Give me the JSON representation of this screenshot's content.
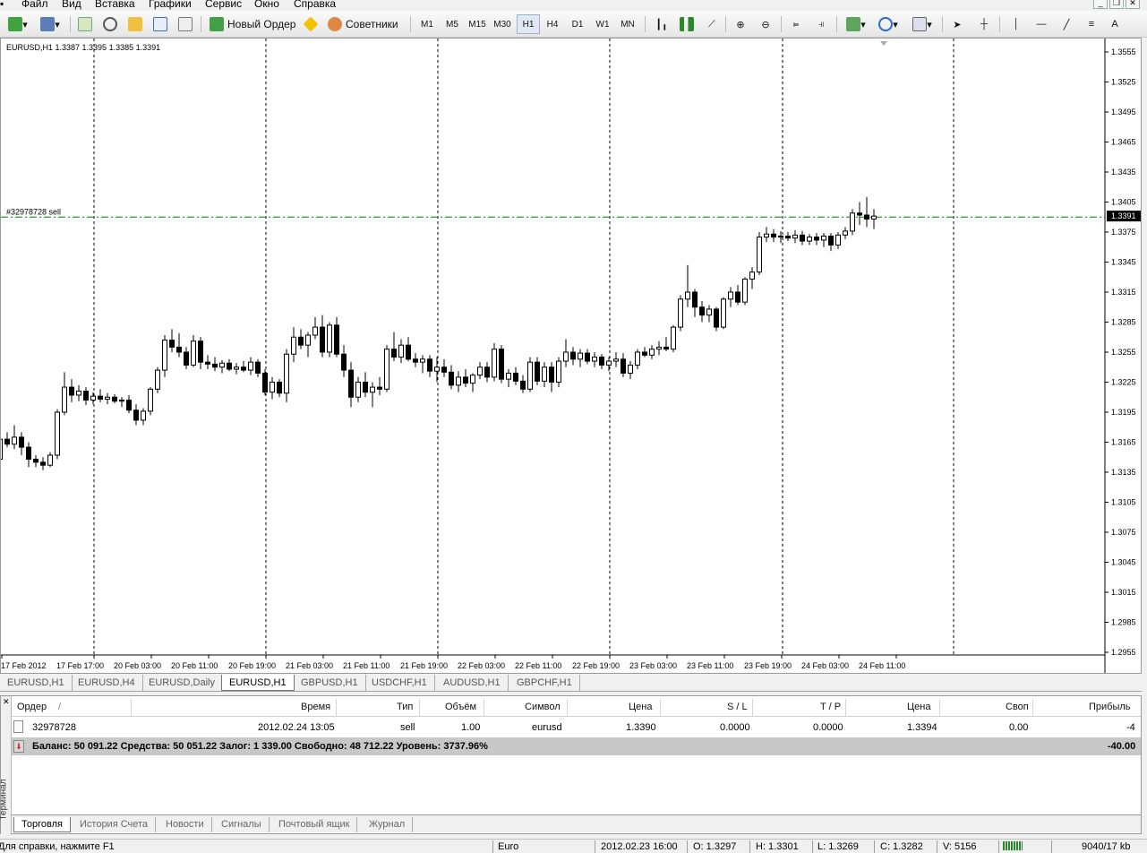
{
  "menu": [
    "Файл",
    "Вид",
    "Вставка",
    "Графики",
    "Сервис",
    "Окно",
    "Справка"
  ],
  "toolbar": {
    "new_order": "Новый Ордер",
    "experts": "Советники",
    "timeframes": [
      "M1",
      "M5",
      "M15",
      "M30",
      "H1",
      "H4",
      "D1",
      "W1",
      "MN"
    ],
    "active_timeframe": "H1"
  },
  "chart": {
    "header": "EURUSD,H1  1.3387 1.3395 1.3385 1.3391",
    "order_label": "#32978728 sell",
    "current_price": "1.3391",
    "order_line_color": "#008000",
    "price_ticks": [
      "1.3555",
      "1.3525",
      "1.3495",
      "1.3465",
      "1.3435",
      "1.3405",
      "1.3375",
      "1.3345",
      "1.3315",
      "1.3285",
      "1.3255",
      "1.3225",
      "1.3195",
      "1.3165",
      "1.3135",
      "1.3105",
      "1.3075",
      "1.3045",
      "1.3015",
      "1.2985",
      "1.2955"
    ],
    "time_ticks": [
      "17 Feb 2012",
      "17 Feb 17:00",
      "20 Feb 03:00",
      "20 Feb 11:00",
      "20 Feb 19:00",
      "21 Feb 03:00",
      "21 Feb 11:00",
      "21 Feb 19:00",
      "22 Feb 03:00",
      "22 Feb 11:00",
      "22 Feb 19:00",
      "23 Feb 03:00",
      "23 Feb 11:00",
      "23 Feb 19:00",
      "24 Feb 03:00",
      "24 Feb 11:00"
    ]
  },
  "chart_data": {
    "type": "candlestick",
    "symbol": "EURUSD",
    "timeframe": "H1",
    "ylim": [
      1.294,
      1.357
    ],
    "candles": [
      [
        1.312,
        1.314,
        1.3115,
        1.3132
      ],
      [
        1.3132,
        1.3138,
        1.3114,
        1.3118
      ],
      [
        1.3118,
        1.3148,
        1.3116,
        1.3145
      ],
      [
        1.3145,
        1.3162,
        1.314,
        1.3155
      ],
      [
        1.3155,
        1.3172,
        1.314,
        1.3142
      ],
      [
        1.3142,
        1.315,
        1.3128,
        1.3135
      ],
      [
        1.3135,
        1.3152,
        1.313,
        1.3148
      ],
      [
        1.3148,
        1.317,
        1.3145,
        1.3168
      ],
      [
        1.3168,
        1.3175,
        1.316,
        1.3163
      ],
      [
        1.3163,
        1.3182,
        1.3158,
        1.317
      ],
      [
        1.317,
        1.3175,
        1.3152,
        1.316
      ],
      [
        1.316,
        1.3165,
        1.314,
        1.3148
      ],
      [
        1.3148,
        1.3152,
        1.314,
        1.3145
      ],
      [
        1.3145,
        1.315,
        1.3137,
        1.3142
      ],
      [
        1.3142,
        1.3155,
        1.314,
        1.3152
      ],
      [
        1.3152,
        1.3198,
        1.3148,
        1.3195
      ],
      [
        1.3195,
        1.3235,
        1.3192,
        1.322
      ],
      [
        1.322,
        1.3228,
        1.3205,
        1.3212
      ],
      [
        1.3212,
        1.3222,
        1.3206,
        1.3216
      ],
      [
        1.3216,
        1.322,
        1.3202,
        1.3207
      ],
      [
        1.3207,
        1.3215,
        1.3203,
        1.3211
      ],
      [
        1.3211,
        1.3218,
        1.3205,
        1.3208
      ],
      [
        1.3208,
        1.3214,
        1.3203,
        1.321
      ],
      [
        1.321,
        1.3213,
        1.3204,
        1.3206
      ],
      [
        1.3206,
        1.321,
        1.32,
        1.3207
      ],
      [
        1.3207,
        1.3212,
        1.3194,
        1.3197
      ],
      [
        1.3197,
        1.3203,
        1.3182,
        1.3187
      ],
      [
        1.3187,
        1.3199,
        1.3182,
        1.3196
      ],
      [
        1.3196,
        1.322,
        1.3192,
        1.3218
      ],
      [
        1.3218,
        1.324,
        1.3214,
        1.3237
      ],
      [
        1.3237,
        1.3272,
        1.323,
        1.3267
      ],
      [
        1.3267,
        1.3278,
        1.3255,
        1.326
      ],
      [
        1.326,
        1.3274,
        1.325,
        1.3255
      ],
      [
        1.3255,
        1.326,
        1.3238,
        1.3242
      ],
      [
        1.3242,
        1.3272,
        1.324,
        1.3266
      ],
      [
        1.3266,
        1.327,
        1.3238,
        1.3245
      ],
      [
        1.3245,
        1.3252,
        1.3238,
        1.3243
      ],
      [
        1.3243,
        1.325,
        1.3236,
        1.324
      ],
      [
        1.324,
        1.3247,
        1.3234,
        1.3244
      ],
      [
        1.3244,
        1.3248,
        1.3236,
        1.3238
      ],
      [
        1.3238,
        1.3244,
        1.3233,
        1.324
      ],
      [
        1.324,
        1.3246,
        1.3235,
        1.3237
      ],
      [
        1.3237,
        1.325,
        1.3232,
        1.3245
      ],
      [
        1.3245,
        1.3248,
        1.323,
        1.3234
      ],
      [
        1.3234,
        1.3238,
        1.3212,
        1.3215
      ],
      [
        1.3215,
        1.323,
        1.3208,
        1.3225
      ],
      [
        1.3225,
        1.3228,
        1.321,
        1.3214
      ],
      [
        1.3214,
        1.3258,
        1.3205,
        1.3253
      ],
      [
        1.3253,
        1.328,
        1.3245,
        1.327
      ],
      [
        1.327,
        1.3278,
        1.3258,
        1.3262
      ],
      [
        1.3262,
        1.3275,
        1.325,
        1.3272
      ],
      [
        1.3272,
        1.329,
        1.3268,
        1.328
      ],
      [
        1.328,
        1.3292,
        1.325,
        1.3255
      ],
      [
        1.3255,
        1.3285,
        1.325,
        1.3282
      ],
      [
        1.3282,
        1.329,
        1.325,
        1.3253
      ],
      [
        1.3253,
        1.3262,
        1.323,
        1.3237
      ],
      [
        1.3237,
        1.3245,
        1.32,
        1.321
      ],
      [
        1.321,
        1.323,
        1.3205,
        1.3225
      ],
      [
        1.3225,
        1.3235,
        1.321,
        1.3215
      ],
      [
        1.3215,
        1.3225,
        1.32,
        1.322
      ],
      [
        1.322,
        1.323,
        1.3212,
        1.3218
      ],
      [
        1.3218,
        1.3262,
        1.3215,
        1.3258
      ],
      [
        1.3258,
        1.3275,
        1.3246,
        1.325
      ],
      [
        1.325,
        1.3268,
        1.3244,
        1.3262
      ],
      [
        1.3262,
        1.327,
        1.3246,
        1.3248
      ],
      [
        1.3248,
        1.3254,
        1.324,
        1.3245
      ],
      [
        1.3245,
        1.3252,
        1.3234,
        1.3248
      ],
      [
        1.3248,
        1.3252,
        1.323,
        1.3236
      ],
      [
        1.3236,
        1.325,
        1.3225,
        1.324
      ],
      [
        1.324,
        1.3248,
        1.323,
        1.3235
      ],
      [
        1.3235,
        1.3242,
        1.3218,
        1.3222
      ],
      [
        1.3222,
        1.3236,
        1.3215,
        1.323
      ],
      [
        1.323,
        1.3238,
        1.322,
        1.3224
      ],
      [
        1.3224,
        1.3234,
        1.3215,
        1.3232
      ],
      [
        1.3232,
        1.3245,
        1.3228,
        1.324
      ],
      [
        1.324,
        1.3245,
        1.3225,
        1.323
      ],
      [
        1.323,
        1.3264,
        1.3226,
        1.3258
      ],
      [
        1.3258,
        1.3262,
        1.3224,
        1.3228
      ],
      [
        1.3228,
        1.3238,
        1.322,
        1.3234
      ],
      [
        1.3234,
        1.324,
        1.3222,
        1.3226
      ],
      [
        1.3226,
        1.3232,
        1.3214,
        1.3218
      ],
      [
        1.3218,
        1.325,
        1.3215,
        1.3245
      ],
      [
        1.3245,
        1.325,
        1.3222,
        1.3226
      ],
      [
        1.3226,
        1.3245,
        1.322,
        1.324
      ],
      [
        1.324,
        1.3245,
        1.3215,
        1.3225
      ],
      [
        1.3225,
        1.325,
        1.322,
        1.3246
      ],
      [
        1.3246,
        1.3268,
        1.324,
        1.3255
      ],
      [
        1.3255,
        1.326,
        1.3242,
        1.3248
      ],
      [
        1.3248,
        1.3258,
        1.324,
        1.3254
      ],
      [
        1.3254,
        1.3258,
        1.3243,
        1.3246
      ],
      [
        1.3246,
        1.3255,
        1.324,
        1.325
      ],
      [
        1.325,
        1.3253,
        1.3238,
        1.3242
      ],
      [
        1.3242,
        1.325,
        1.3236,
        1.3246
      ],
      [
        1.3246,
        1.3255,
        1.324,
        1.3248
      ],
      [
        1.3248,
        1.3254,
        1.323,
        1.3234
      ],
      [
        1.3234,
        1.3246,
        1.3228,
        1.3242
      ],
      [
        1.3242,
        1.3258,
        1.3238,
        1.3255
      ],
      [
        1.3255,
        1.326,
        1.325,
        1.3252
      ],
      [
        1.3252,
        1.3262,
        1.3248,
        1.3258
      ],
      [
        1.3258,
        1.3266,
        1.3252,
        1.326
      ],
      [
        1.326,
        1.327,
        1.3256,
        1.3258
      ],
      [
        1.3258,
        1.3282,
        1.3255,
        1.328
      ],
      [
        1.328,
        1.3312,
        1.3276,
        1.3308
      ],
      [
        1.3308,
        1.3342,
        1.33,
        1.3315
      ],
      [
        1.3315,
        1.3318,
        1.329,
        1.33
      ],
      [
        1.33,
        1.3306,
        1.3285,
        1.3292
      ],
      [
        1.3292,
        1.3302,
        1.3285,
        1.3298
      ],
      [
        1.3298,
        1.33,
        1.3276,
        1.328
      ],
      [
        1.328,
        1.331,
        1.3278,
        1.3308
      ],
      [
        1.3308,
        1.332,
        1.33,
        1.3315
      ],
      [
        1.3315,
        1.3322,
        1.3302,
        1.3305
      ],
      [
        1.3305,
        1.333,
        1.3302,
        1.3328
      ],
      [
        1.3328,
        1.334,
        1.3318,
        1.3335
      ],
      [
        1.3335,
        1.3375,
        1.3332,
        1.337
      ],
      [
        1.337,
        1.338,
        1.3365,
        1.3373
      ],
      [
        1.3373,
        1.3378,
        1.3365,
        1.337
      ],
      [
        1.337,
        1.3376,
        1.3364,
        1.3371
      ],
      [
        1.3371,
        1.3375,
        1.3366,
        1.3369
      ],
      [
        1.3369,
        1.3377,
        1.3364,
        1.3372
      ],
      [
        1.3372,
        1.3376,
        1.3362,
        1.3366
      ],
      [
        1.3366,
        1.3373,
        1.3362,
        1.337
      ],
      [
        1.337,
        1.3374,
        1.3362,
        1.3367
      ],
      [
        1.3367,
        1.3374,
        1.336,
        1.3371
      ],
      [
        1.3371,
        1.3374,
        1.3356,
        1.3362
      ],
      [
        1.3362,
        1.3375,
        1.3358,
        1.3372
      ],
      [
        1.3372,
        1.338,
        1.3368,
        1.3376
      ],
      [
        1.3376,
        1.3398,
        1.3372,
        1.3394
      ],
      [
        1.3394,
        1.3405,
        1.3382,
        1.3392
      ],
      [
        1.3392,
        1.341,
        1.338,
        1.3388
      ],
      [
        1.3388,
        1.3398,
        1.3378,
        1.3391
      ]
    ]
  },
  "chart_tabs": [
    "EURUSD,H1",
    "EURUSD,H4",
    "EURUSD,Daily",
    "EURUSD,H1",
    "GBPUSD,H1",
    "USDCHF,H1",
    "AUDUSD,H1",
    "GBPCHF,H1"
  ],
  "active_chart_tab_index": 3,
  "terminal": {
    "side_label": "Терминал",
    "columns": [
      "Ордер",
      "/",
      "Время",
      "Тип",
      "Объём",
      "Символ",
      "Цена",
      "S / L",
      "T / P",
      "Цена",
      "Своп",
      "Прибыль"
    ],
    "order": {
      "id": "32978728",
      "time": "2012.02.24 13:05",
      "type": "sell",
      "volume": "1.00",
      "symbol": "eurusd",
      "price": "1.3390",
      "sl": "0.0000",
      "tp": "0.0000",
      "current_price": "1.3394",
      "swap": "0.00",
      "profit": "-4"
    },
    "balance_line": "Баланс: 50 091.22  Средства: 50 051.22  Залог: 1 339.00  Свободно: 48 712.22  Уровень: 3737.96%",
    "total_profit": "-40.00",
    "tabs": [
      "Торговля",
      "История Счета",
      "Новости",
      "Сигналы",
      "Почтовый ящик",
      "Журнал"
    ]
  },
  "status": {
    "help": "Для справки, нажмите F1",
    "profile": "Euro",
    "datetime": "2012.02.23 16:00",
    "open": "O: 1.3297",
    "high": "H: 1.3301",
    "low": "L: 1.3269",
    "close": "C: 1.3282",
    "volume": "V: 5156",
    "traffic": "9040/17 kb"
  }
}
